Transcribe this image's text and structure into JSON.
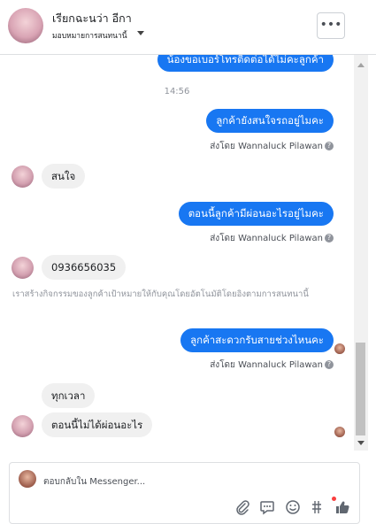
{
  "header": {
    "name": "เรียกฉะนว่า อีกา",
    "subtitle": "มอบหมายการสนทนานี้"
  },
  "messages": {
    "partial_top": "น้องขอเบอร์โทรติดต่อได้ไม่คะลูกค้า",
    "time": "14:56",
    "out1": "ลูกค้ายังสนใจรถอยู่ไมคะ",
    "sent_by1": "ส่งโดย Wannaluck Pilawan",
    "in1": "สนใจ",
    "out2": "ตอนนี้ลูกค้ามีผ่อนอะไรอยู่ไมคะ",
    "sent_by2": "ส่งโดย Wannaluck Pilawan",
    "in2": "0936656035",
    "notice": "เราสร้างกิจกรรมของลูกค้าเป้าหมายให้กับคุณโดยอัตโนมัติโดยอิงตามการสนทนานี้",
    "out3": "ลูกค้าสะดวกรับสายช่วงไหนคะ",
    "sent_by3": "ส่งโดย Wannaluck Pilawan",
    "in3": "ทุกเวลา",
    "in4": "ตอนนี้ไม่ได้ผ่อนอะไร"
  },
  "composer": {
    "placeholder": "ตอบกลับใน Messenger..."
  },
  "icons": [
    "more-icon",
    "help-icon",
    "attach-icon",
    "saved-replies-icon",
    "emoji-icon",
    "tag-icon",
    "like-icon"
  ],
  "colors": {
    "accent": "#1877f2",
    "incoming_bubble": "#f0f0f0",
    "muted_text": "#90949c"
  }
}
